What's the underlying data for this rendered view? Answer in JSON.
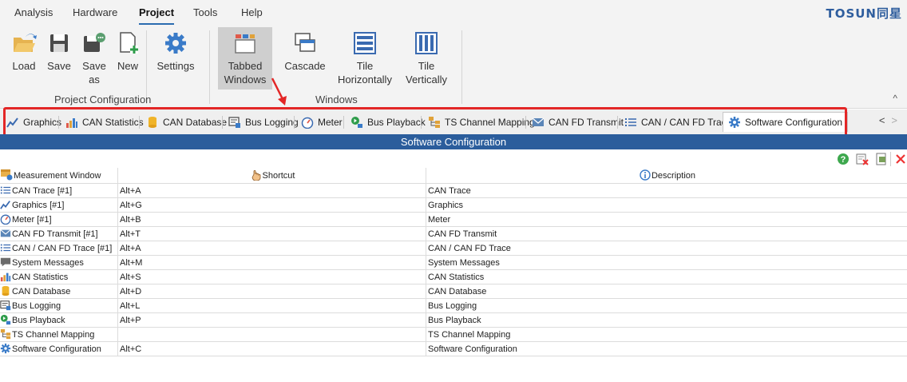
{
  "menu": {
    "items": [
      "Analysis",
      "Hardware",
      "Project",
      "Tools",
      "Help"
    ],
    "active": "Project",
    "brand": "TOSUN同星"
  },
  "ribbon": {
    "load": "Load",
    "save": "Save",
    "save_as": "Save as",
    "new": "New",
    "settings": "Settings",
    "tabbed_windows": "Tabbed Windows",
    "cascade": "Cascade",
    "tile_horizontally": "Tile Horizontally",
    "tile_vertically": "Tile Vertically",
    "group_project": "Project Configuration",
    "group_windows": "Windows",
    "collapse": "^"
  },
  "tabs": [
    {
      "label": "Graphics",
      "icon": "graphics-icon"
    },
    {
      "label": "CAN Statistics",
      "icon": "statistics-icon"
    },
    {
      "label": "CAN Database",
      "icon": "database-icon"
    },
    {
      "label": "Bus Logging",
      "icon": "bus-logging-icon"
    },
    {
      "label": "Meter",
      "icon": "meter-icon"
    },
    {
      "label": "Bus Playback",
      "icon": "bus-playback-icon"
    },
    {
      "label": "TS Channel Mapping",
      "icon": "channel-mapping-icon"
    },
    {
      "label": "CAN FD Transmit",
      "icon": "transmit-icon"
    },
    {
      "label": "CAN / CAN FD Trace",
      "icon": "trace-icon"
    },
    {
      "label": "Software Configuration",
      "icon": "gear-icon",
      "active": true
    }
  ],
  "tab_scroll": {
    "left": "<",
    "right": ">"
  },
  "window_title": "Software Configuration",
  "toolbar": {
    "help": "help-icon",
    "clear_filter": "clear-filter-icon",
    "export": "export-icon",
    "close": "close-icon"
  },
  "table": {
    "headers": [
      "Measurement Window",
      "Shortcut",
      "Description"
    ],
    "rows": [
      {
        "window": "CAN Trace [#1]",
        "shortcut": "Alt+A",
        "description": "CAN Trace",
        "icon": "trace-icon"
      },
      {
        "window": "Graphics [#1]",
        "shortcut": "Alt+G",
        "description": "Graphics",
        "icon": "graphics-icon"
      },
      {
        "window": "Meter [#1]",
        "shortcut": "Alt+B",
        "description": "Meter",
        "icon": "meter-icon"
      },
      {
        "window": "CAN FD Transmit [#1]",
        "shortcut": "Alt+T",
        "description": "CAN FD Transmit",
        "icon": "transmit-icon"
      },
      {
        "window": "CAN / CAN FD Trace [#1]",
        "shortcut": "Alt+A",
        "description": "CAN / CAN FD Trace",
        "icon": "trace-icon"
      },
      {
        "window": "System Messages",
        "shortcut": "Alt+M",
        "description": "System Messages",
        "icon": "message-icon"
      },
      {
        "window": "CAN Statistics",
        "shortcut": "Alt+S",
        "description": "CAN Statistics",
        "icon": "statistics-icon"
      },
      {
        "window": "CAN Database",
        "shortcut": "Alt+D",
        "description": "CAN Database",
        "icon": "database-icon"
      },
      {
        "window": "Bus Logging",
        "shortcut": "Alt+L",
        "description": "Bus Logging",
        "icon": "bus-logging-icon"
      },
      {
        "window": "Bus Playback",
        "shortcut": "Alt+P",
        "description": "Bus Playback",
        "icon": "bus-playback-icon"
      },
      {
        "window": "TS Channel Mapping",
        "shortcut": "",
        "description": "TS Channel Mapping",
        "icon": "channel-mapping-icon"
      },
      {
        "window": "Software Configuration",
        "shortcut": "Alt+C",
        "description": "Software Configuration",
        "icon": "gear-icon"
      }
    ]
  },
  "colors": {
    "accent": "#2b5d9c",
    "highlight": "#e32626",
    "pressed": "#cfcfcf"
  }
}
